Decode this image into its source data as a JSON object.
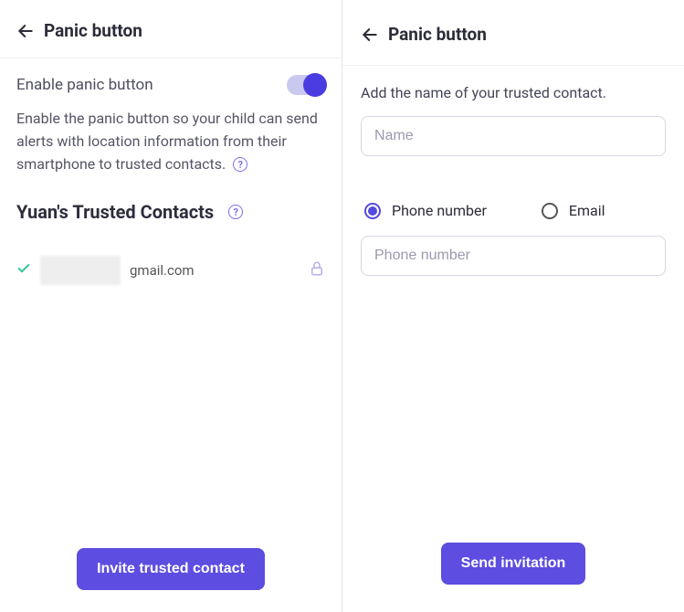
{
  "left": {
    "title": "Panic button",
    "toggle_label": "Enable panic button",
    "toggle_on": true,
    "description": "Enable the panic button so your child can send alerts with location information from their smartphone to trusted contacts.",
    "trusted_heading": "Yuan's Trusted Contacts",
    "contact_email_suffix": "gmail.com",
    "invite_button": "Invite trusted contact"
  },
  "right": {
    "title": "Panic button",
    "prompt": "Add the name of your trusted contact.",
    "name_placeholder": "Name",
    "radio_phone": "Phone number",
    "radio_email": "Email",
    "selected": "phone",
    "phone_placeholder": "Phone number",
    "send_button": "Send invitation"
  }
}
